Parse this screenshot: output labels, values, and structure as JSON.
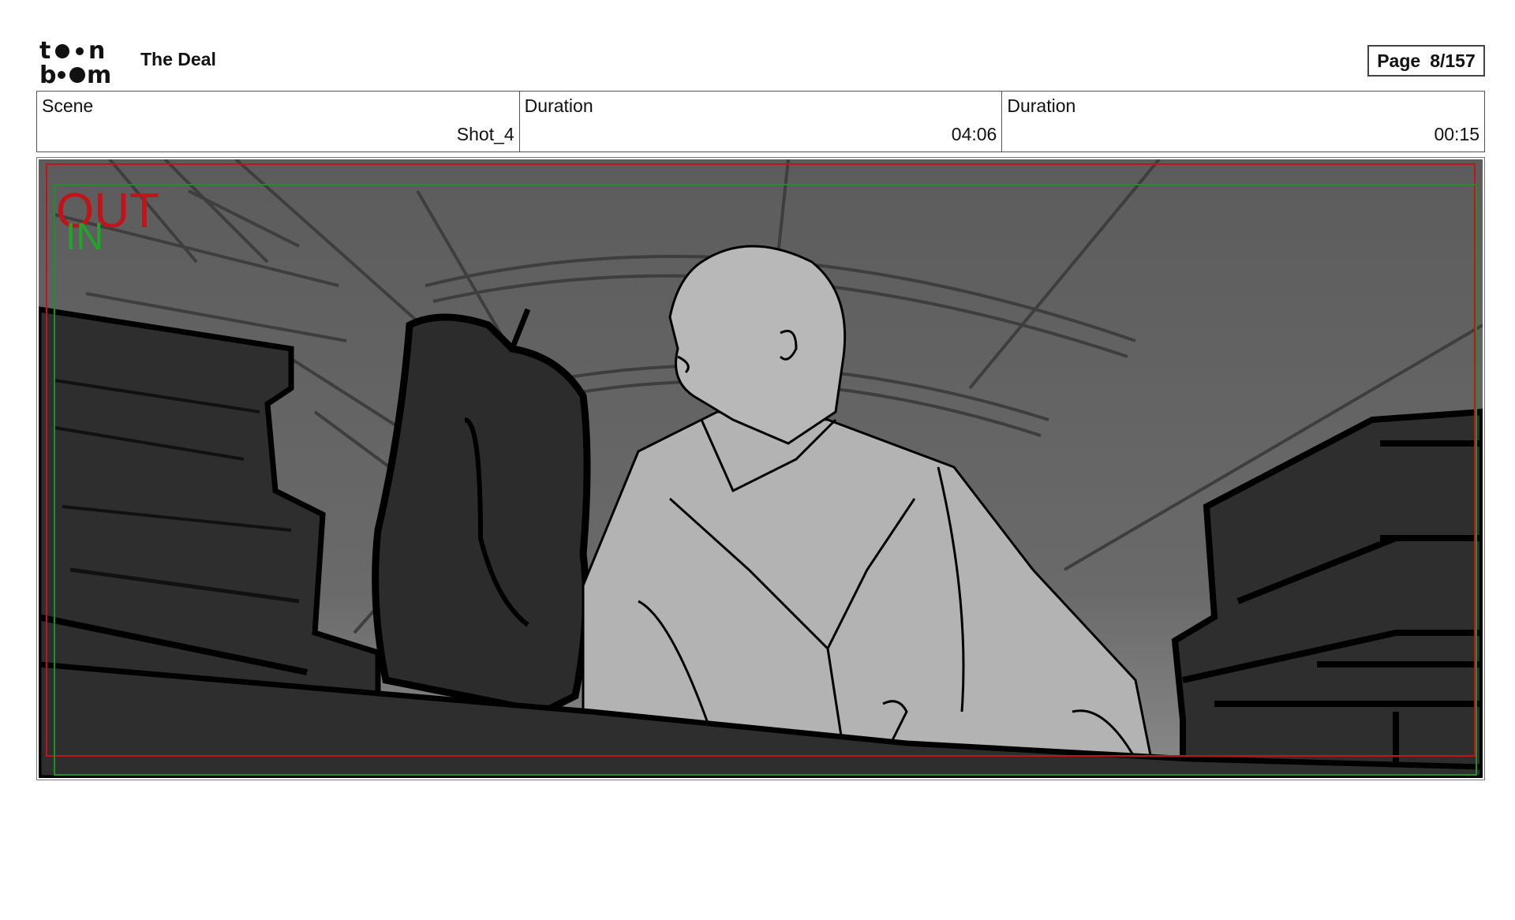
{
  "header": {
    "project_title": "The Deal",
    "page_label": "Page",
    "page_value": "8/157"
  },
  "info": [
    {
      "label": "Scene",
      "value": "Shot_4"
    },
    {
      "label": "Duration",
      "value": "04:06"
    },
    {
      "label": "Duration",
      "value": "00:15"
    }
  ],
  "panel": {
    "out_label": "OUT",
    "in_label": "IN",
    "colors": {
      "out_frame": "#c0141a",
      "in_frame": "#1f8f2a",
      "background": "#5a5a5a",
      "foreground": "#2e2e2e",
      "figure": "#b3b3b3"
    }
  },
  "logo": {
    "text": "toonboom",
    "icon": "toonboom-logo"
  }
}
